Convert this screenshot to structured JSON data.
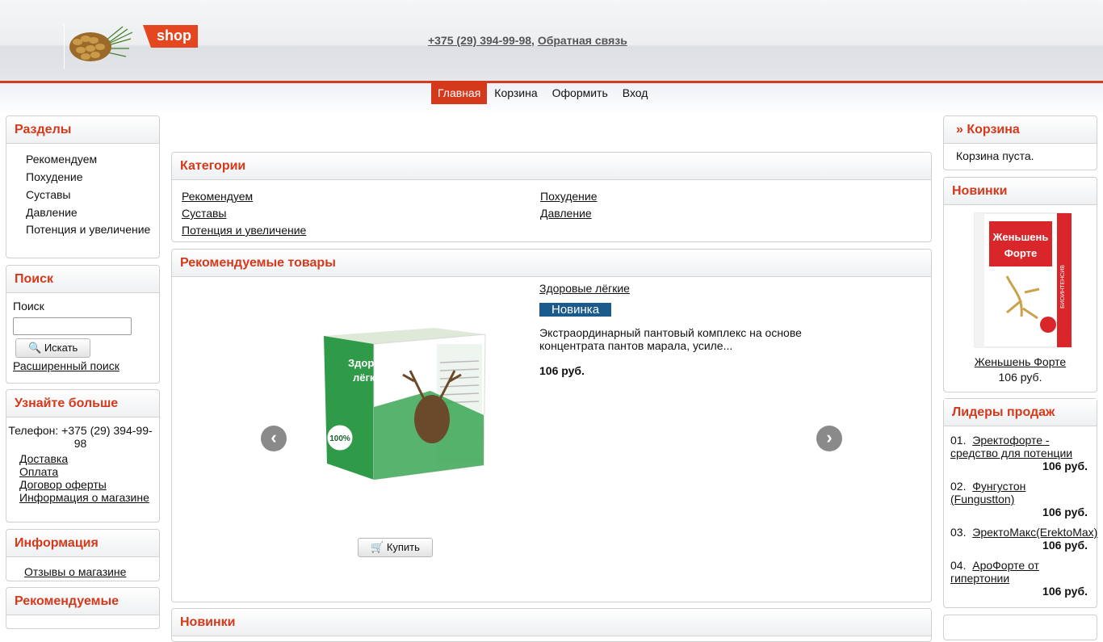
{
  "header": {
    "logo_text": "shop",
    "phone": "+375 (29) 394-99-98",
    "separator": ",",
    "feedback": "Обратная связь"
  },
  "nav": [
    "Главная",
    "Корзина",
    "Оформить",
    "Вход"
  ],
  "left": {
    "sections": {
      "title": "Разделы",
      "items": [
        "Рекомендуем",
        "Похудение",
        "Суставы",
        "Давление",
        "Потенция и увеличение"
      ]
    },
    "search": {
      "title": "Поиск",
      "label": "Поиск",
      "value": "",
      "button": "Искать",
      "advanced": "Расширенный поиск"
    },
    "learn": {
      "title": "Узнайте больше",
      "phone": "Телефон: +375 (29) 394-99-98",
      "links": [
        "Доставка",
        "Оплата",
        "Договор оферты",
        "Информация о магазине"
      ]
    },
    "info": {
      "title": "Информация",
      "links": [
        "Отзывы о магазине"
      ]
    },
    "recommended_title": "Рекомендуемые"
  },
  "center": {
    "categories": {
      "title": "Категории",
      "items": [
        "Рекомендуем",
        "Похудение",
        "Суставы",
        "Давление",
        "Потенция и увеличение"
      ]
    },
    "featured": {
      "title": "Рекомендуемые товары",
      "product_name": "Здоровые лёгкие",
      "badge": "Новинка",
      "description": "Экстраординарный пантовый комплекс на основе концентрата пантов марала, усиле...",
      "price": "106 руб.",
      "buy_button": "Купить",
      "box_text_1": "Здоровые",
      "box_text_2": "лёгкие",
      "box_badge": "100%"
    },
    "new_title": "Новинки"
  },
  "right": {
    "cart": {
      "title": "» Корзина",
      "text": "Корзина пуста."
    },
    "new": {
      "title": "Новинки",
      "product_name": "Женьшень Форте",
      "price": "106 руб.",
      "box_text_1": "Женьшень",
      "box_text_2": "Форте",
      "box_side": "БИОИНТЕНСИВ"
    },
    "leaders": {
      "title": "Лидеры продаж",
      "items": [
        {
          "num": "01.",
          "name": "Эректофорте - средство для потенции",
          "price": "106 руб."
        },
        {
          "num": "02.",
          "name": "Фунгустон (Fungustton)",
          "price": "106 руб."
        },
        {
          "num": "03.",
          "name": "ЭректоМакс(ErektoMax)",
          "price": "106 руб."
        },
        {
          "num": "04.",
          "name": "АроФорте от гипертонии",
          "price": "106 руб."
        }
      ]
    }
  },
  "colors": {
    "accent": "#d5391c",
    "badge": "#1b5a8c"
  }
}
